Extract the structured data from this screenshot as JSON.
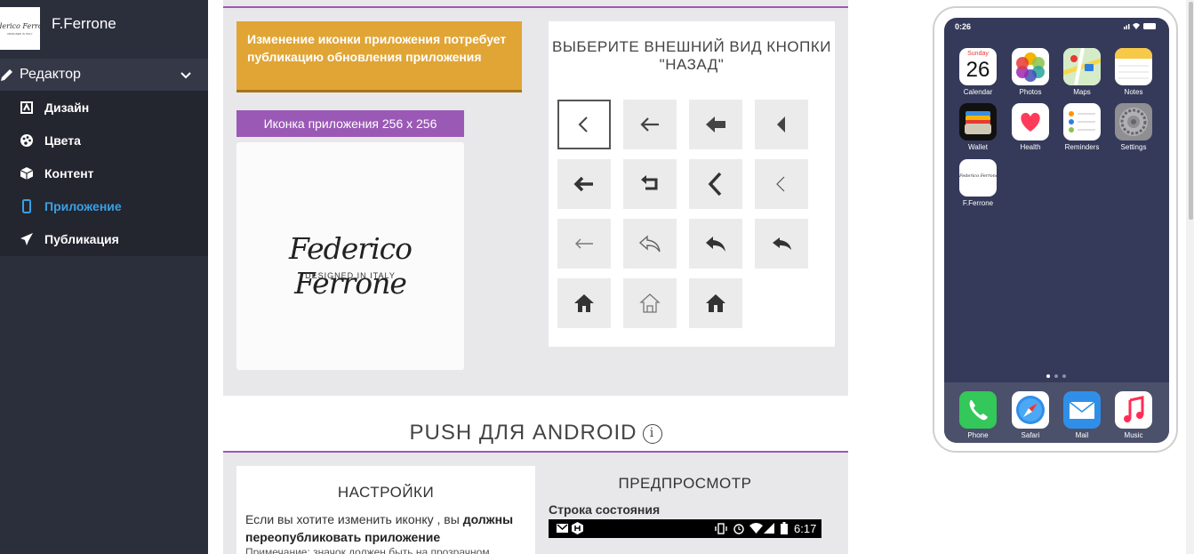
{
  "brand": {
    "name": "F.Ferrone",
    "logo_text": "Federico Ferrone",
    "logo_sub": "DESIGNED IN ITALY"
  },
  "menu": {
    "editor_label": "Редактор",
    "items": [
      {
        "label": "Дизайн",
        "icon": "design-icon"
      },
      {
        "label": "Цвета",
        "icon": "palette-icon"
      },
      {
        "label": "Контент",
        "icon": "cube-icon"
      },
      {
        "label": "Приложение",
        "icon": "mobile-icon",
        "active": true
      },
      {
        "label": "Публикация",
        "icon": "paper-plane-icon"
      }
    ]
  },
  "app_icon": {
    "notice": "Изменение иконки приложения потребует публикацию обновления приложения",
    "badge": "Иконка приложения 256 x 256",
    "preview_title": "Federico Ferrone",
    "preview_subtitle": "DESIGNED IN ITALY"
  },
  "back_button": {
    "title": "ВЫБЕРИТЕ ВНЕШНИЙ ВИД КНОПКИ \"НАЗАД\"",
    "options": [
      "chevron-thin",
      "arrow-thin",
      "arrow-bold",
      "triangle",
      "arrow-medium",
      "return-arrow",
      "chevron-bold",
      "chevron-light",
      "arrow-light",
      "reply-outline",
      "reply-solid",
      "reply-all",
      "home-solid",
      "home-outline",
      "home-fill"
    ],
    "selected_index": 0
  },
  "push": {
    "title": "PUSH ДЛЯ ANDROID",
    "info_icon": "i",
    "settings_title": "НАСТРОЙКИ",
    "settings_text_1": "Если вы хотите изменить иконку , вы ",
    "settings_text_bold": "должны переопубликовать приложение",
    "settings_note": "Примечание: значок должен быть на прозрачном",
    "preview_title": "ПРЕДПРОСМОТР",
    "status_label": "Строка состояния",
    "status_time": "6:17"
  },
  "phone": {
    "time": "0:26",
    "calendar_day": "Sunday",
    "calendar_date": "26",
    "apps": [
      "Calendar",
      "Photos",
      "Maps",
      "Notes",
      "Wallet",
      "Health",
      "Reminders",
      "Settings",
      "F.Ferrone"
    ],
    "dock": [
      "Phone",
      "Safari",
      "Mail",
      "Music"
    ],
    "ferrone_tile_text": "Federico Ferrone"
  },
  "colors": {
    "sidebar": "#2b2e3b",
    "accent": "#9b59b6",
    "notice": "#e0a535",
    "active": "#3aa0e4"
  }
}
